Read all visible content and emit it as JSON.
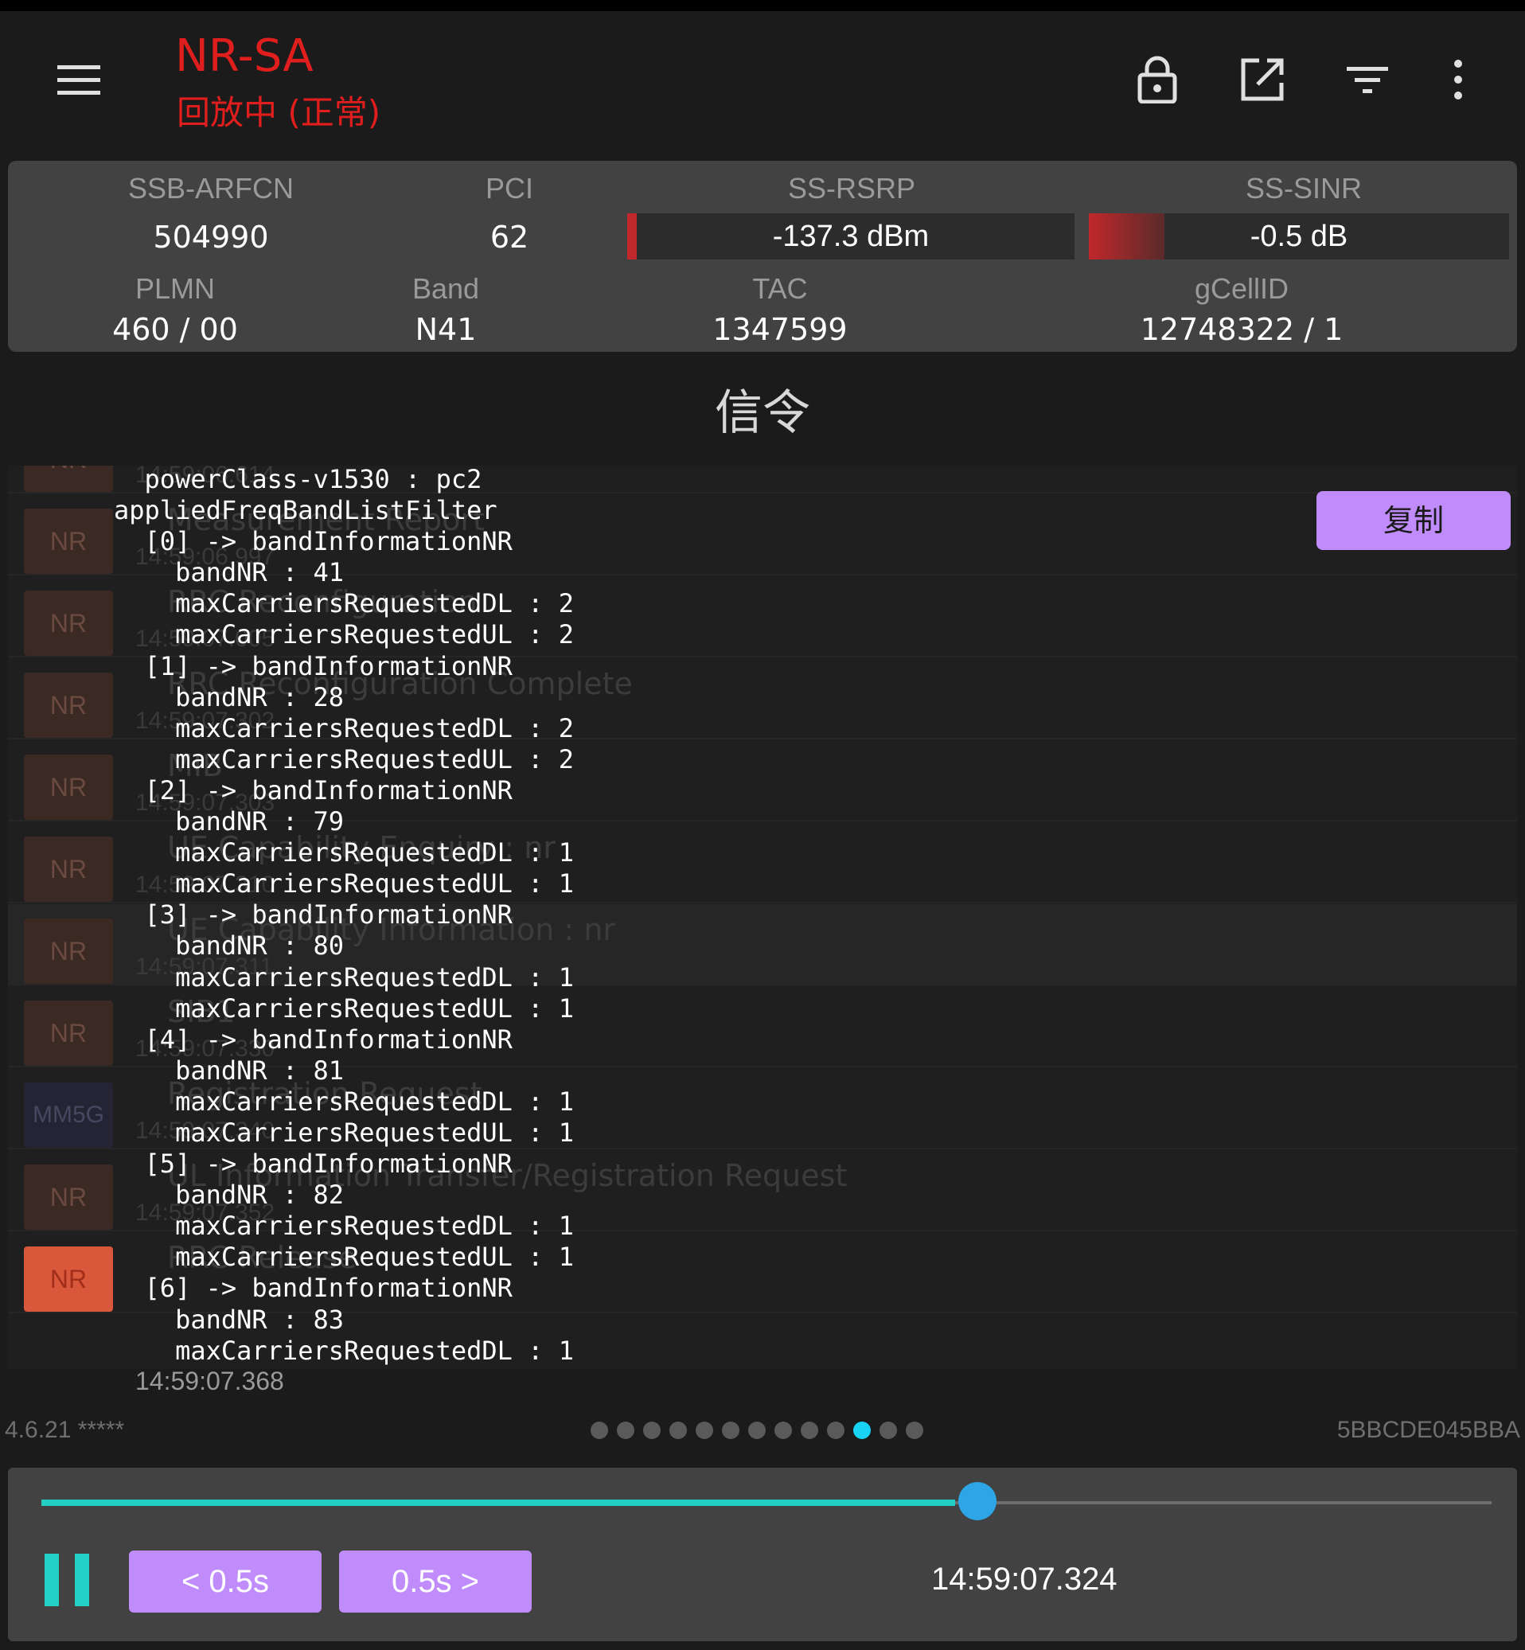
{
  "header": {
    "title": "NR-SA",
    "subtitle": "回放中 (正常)",
    "icons": [
      "menu-icon",
      "lock-icon",
      "open-external-icon",
      "filter-icon",
      "more-vert-icon"
    ]
  },
  "info": {
    "ssb_arfcn_label": "SSB-ARFCN",
    "ssb_arfcn": "504990",
    "pci_label": "PCI",
    "pci": "62",
    "rsrp_label": "SS-RSRP",
    "rsrp": "-137.3 dBm",
    "rsrp_level": 0.02,
    "sinr_label": "SS-SINR",
    "sinr": "-0.5 dB",
    "sinr_level": 0.18,
    "plmn_label": "PLMN",
    "plmn": "460 / 00",
    "band_label": "Band",
    "band": "N41",
    "tac_label": "TAC",
    "tac": "1347599",
    "gcellid_label": "gCellID",
    "gcellid": "12748322 / 1",
    "meter_color": "#c0282b"
  },
  "section_title": "信令",
  "rows": [
    {
      "tag": "NR",
      "title": "Measurement Report",
      "time": "14:59:06.614"
    },
    {
      "tag": "NR",
      "title": "Measurement Report",
      "time": "14:59:06.997"
    },
    {
      "tag": "NR",
      "title": "RRC Reconfiguration",
      "time": "14:59:07.005"
    },
    {
      "tag": "NR",
      "title": "RRC Reconfiguration Complete",
      "time": "14:59:07.302"
    },
    {
      "tag": "NR",
      "title": "MIB",
      "time": "14:59:07.303"
    },
    {
      "tag": "NR",
      "title": "UE Capability Enquiry : nr",
      "time": "14:59:07.310"
    },
    {
      "tag": "NR",
      "title": "UE Capability Information : nr",
      "time": "14:59:07.311"
    },
    {
      "tag": "NR",
      "title": "SIB1",
      "time": "14:59:07.330"
    },
    {
      "tag": "MM5G",
      "title": "Registration Request",
      "time": "14:59:07.340"
    },
    {
      "tag": "NR",
      "title": "UL Information Transfer/Registration Request",
      "time": "14:59:07.352"
    },
    {
      "tag": "NR",
      "title": "RRC Release",
      "time": "14:59:07.368"
    }
  ],
  "detail_lines": [
    "  powerClass-v1530 : pc2",
    "appliedFreqBandListFilter",
    "  [0] -> bandInformationNR",
    "    bandNR : 41",
    "    maxCarriersRequestedDL : 2",
    "    maxCarriersRequestedUL : 2",
    "  [1] -> bandInformationNR",
    "    bandNR : 28",
    "    maxCarriersRequestedDL : 2",
    "    maxCarriersRequestedUL : 2",
    "  [2] -> bandInformationNR",
    "    bandNR : 79",
    "    maxCarriersRequestedDL : 1",
    "    maxCarriersRequestedUL : 1",
    "  [3] -> bandInformationNR",
    "    bandNR : 80",
    "    maxCarriersRequestedDL : 1",
    "    maxCarriersRequestedUL : 1",
    "  [4] -> bandInformationNR",
    "    bandNR : 81",
    "    maxCarriersRequestedDL : 1",
    "    maxCarriersRequestedUL : 1",
    "  [5] -> bandInformationNR",
    "    bandNR : 82",
    "    maxCarriersRequestedDL : 1",
    "    maxCarriersRequestedUL : 1",
    "  [6] -> bandInformationNR",
    "    bandNR : 83",
    "    maxCarriersRequestedDL : 1"
  ],
  "copy_label": "复制",
  "last_time": "14:59:07.368",
  "footer": {
    "version": "4.6.21 *****",
    "device_id": "5BBCDE045BBA",
    "page_count": 13,
    "active_page": 10
  },
  "player": {
    "progress": 0.63,
    "back_label": "< 0.5s",
    "forward_label": "0.5s >",
    "time": "14:59:07.324",
    "pause_icon": "pause-icon"
  }
}
